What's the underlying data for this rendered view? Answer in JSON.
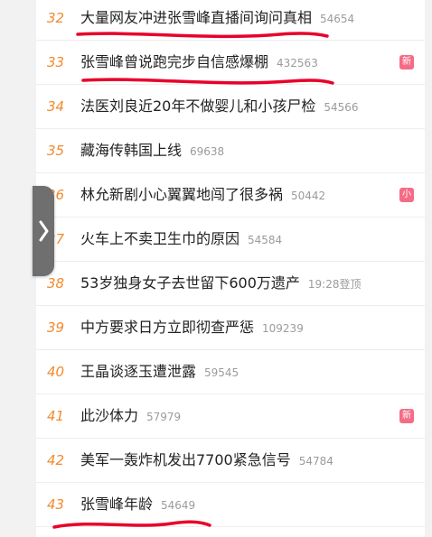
{
  "accent": "#f28a2c",
  "badge_colors": {
    "new": "#f46c85",
    "hot": "#f46c85"
  },
  "rows": [
    {
      "rank": "32",
      "title": "大量网友冲进张雪峰直播间询问真相",
      "count": "54654",
      "badge": null,
      "underlined": true
    },
    {
      "rank": "33",
      "title": "张雪峰曾说跑完步自信感爆棚",
      "count": "432563",
      "badge": "新",
      "underlined": true
    },
    {
      "rank": "34",
      "title": "法医刘良近20年不做婴儿和小孩尸检",
      "count": "54566",
      "badge": null,
      "underlined": false
    },
    {
      "rank": "35",
      "title": "藏海传韩国上线",
      "count": "69638",
      "badge": null,
      "underlined": false
    },
    {
      "rank": "36",
      "title": "林允新剧小心翼翼地闯了很多祸",
      "count": "50442",
      "badge": "小",
      "underlined": false
    },
    {
      "rank": "37",
      "title": "火车上不卖卫生巾的原因",
      "count": "54584",
      "badge": null,
      "underlined": false
    },
    {
      "rank": "38",
      "title": "53岁独身女子去世留下600万遗产",
      "count": "19:28登顶",
      "badge": null,
      "underlined": false
    },
    {
      "rank": "39",
      "title": "中方要求日方立即彻查严惩",
      "count": "109239",
      "badge": null,
      "underlined": false
    },
    {
      "rank": "40",
      "title": "王晶谈逐玉遭泄露",
      "count": "59545",
      "badge": null,
      "underlined": false
    },
    {
      "rank": "41",
      "title": "此沙体力",
      "count": "57979",
      "badge": "新",
      "underlined": false
    },
    {
      "rank": "42",
      "title": "美军一轰炸机发出7700紧急信号",
      "count": "54784",
      "badge": null,
      "underlined": false
    },
    {
      "rank": "43",
      "title": "张雪峰年龄",
      "count": "54649",
      "badge": null,
      "underlined": true
    }
  ],
  "handle_icon": "chevron-right-icon",
  "underline_color": "#e8002a"
}
